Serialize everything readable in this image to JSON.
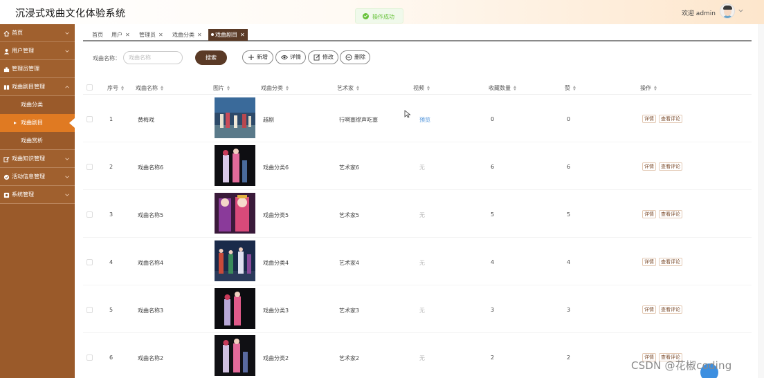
{
  "app": {
    "title": "沉浸式戏曲文化体验系统"
  },
  "header": {
    "welcome": "欢迎 admin"
  },
  "toast": {
    "message": "操作成功"
  },
  "sidebar": {
    "items": [
      {
        "label": "首页",
        "icon": "home-icon"
      },
      {
        "label": "用户管理",
        "icon": "user-icon"
      },
      {
        "label": "管理员管理",
        "icon": "admin-icon"
      },
      {
        "label": "戏曲剧目管理",
        "icon": "book-icon"
      }
    ],
    "sub_items": [
      {
        "label": "戏曲分类"
      },
      {
        "label": "戏曲剧目"
      },
      {
        "label": "戏曲赏析"
      }
    ],
    "items_after": [
      {
        "label": "戏曲知识管理",
        "icon": "edit-icon"
      },
      {
        "label": "活动信息管理",
        "icon": "check-circle-icon"
      },
      {
        "label": "系统管理",
        "icon": "gear-icon"
      }
    ]
  },
  "tabs": [
    {
      "label": "首页"
    },
    {
      "label": "用户"
    },
    {
      "label": "管理员"
    },
    {
      "label": "戏曲分类"
    },
    {
      "label": "戏曲剧目"
    }
  ],
  "tab_close": "✕",
  "search": {
    "label": "戏曲名称：",
    "placeholder": "戏曲名称",
    "button": "搜索"
  },
  "toolbar": {
    "add": "新增",
    "detail": "详情",
    "edit": "修改",
    "delete": "删除"
  },
  "table": {
    "columns": [
      "序号",
      "戏曲名称",
      "图片",
      "戏曲分类",
      "艺术家",
      "视频",
      "收藏数量",
      "赞",
      "操作"
    ],
    "rows": [
      {
        "index": "1",
        "name": "黄梅戏",
        "category": "越剧",
        "artist": "行啊塞缪声吃塞",
        "video": "预览",
        "favorites": "0",
        "likes": "0"
      },
      {
        "index": "2",
        "name": "戏曲名称6",
        "category": "戏曲分类6",
        "artist": "艺术家6",
        "video": "无",
        "favorites": "6",
        "likes": "6"
      },
      {
        "index": "3",
        "name": "戏曲名称5",
        "category": "戏曲分类5",
        "artist": "艺术家5",
        "video": "无",
        "favorites": "5",
        "likes": "5"
      },
      {
        "index": "4",
        "name": "戏曲名称4",
        "category": "戏曲分类4",
        "artist": "艺术家4",
        "video": "无",
        "favorites": "4",
        "likes": "4"
      },
      {
        "index": "5",
        "name": "戏曲名称3",
        "category": "戏曲分类3",
        "artist": "艺术家3",
        "video": "无",
        "favorites": "3",
        "likes": "3"
      },
      {
        "index": "6",
        "name": "戏曲名称2",
        "category": "戏曲分类2",
        "artist": "艺术家2",
        "video": "无",
        "favorites": "2",
        "likes": "2"
      }
    ],
    "row_actions": {
      "detail": "详情",
      "comments": "查看评论"
    }
  },
  "watermark": "CSDN @花椒coding",
  "colors": {
    "sidebar": "#9a5a2a",
    "active_sub": "#e07a22",
    "primary": "#5a3a26",
    "success": "#67c23a",
    "link": "#4a90d9"
  }
}
